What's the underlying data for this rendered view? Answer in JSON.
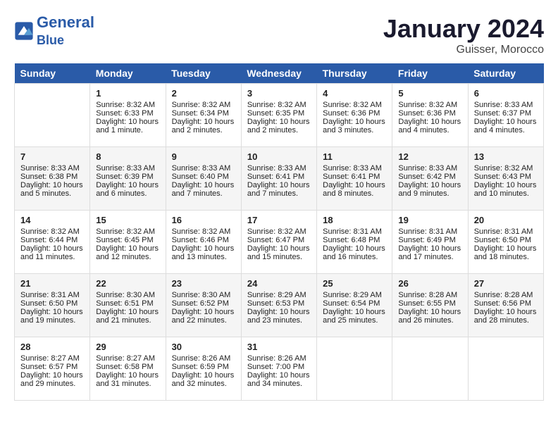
{
  "header": {
    "logo_line1": "General",
    "logo_line2": "Blue",
    "month": "January 2024",
    "location": "Guisser, Morocco"
  },
  "weekdays": [
    "Sunday",
    "Monday",
    "Tuesday",
    "Wednesday",
    "Thursday",
    "Friday",
    "Saturday"
  ],
  "weeks": [
    [
      {
        "day": "",
        "info": ""
      },
      {
        "day": "1",
        "info": "Sunrise: 8:32 AM\nSunset: 6:33 PM\nDaylight: 10 hours\nand 1 minute."
      },
      {
        "day": "2",
        "info": "Sunrise: 8:32 AM\nSunset: 6:34 PM\nDaylight: 10 hours\nand 2 minutes."
      },
      {
        "day": "3",
        "info": "Sunrise: 8:32 AM\nSunset: 6:35 PM\nDaylight: 10 hours\nand 2 minutes."
      },
      {
        "day": "4",
        "info": "Sunrise: 8:32 AM\nSunset: 6:36 PM\nDaylight: 10 hours\nand 3 minutes."
      },
      {
        "day": "5",
        "info": "Sunrise: 8:32 AM\nSunset: 6:36 PM\nDaylight: 10 hours\nand 4 minutes."
      },
      {
        "day": "6",
        "info": "Sunrise: 8:33 AM\nSunset: 6:37 PM\nDaylight: 10 hours\nand 4 minutes."
      }
    ],
    [
      {
        "day": "7",
        "info": "Sunrise: 8:33 AM\nSunset: 6:38 PM\nDaylight: 10 hours\nand 5 minutes."
      },
      {
        "day": "8",
        "info": "Sunrise: 8:33 AM\nSunset: 6:39 PM\nDaylight: 10 hours\nand 6 minutes."
      },
      {
        "day": "9",
        "info": "Sunrise: 8:33 AM\nSunset: 6:40 PM\nDaylight: 10 hours\nand 7 minutes."
      },
      {
        "day": "10",
        "info": "Sunrise: 8:33 AM\nSunset: 6:41 PM\nDaylight: 10 hours\nand 7 minutes."
      },
      {
        "day": "11",
        "info": "Sunrise: 8:33 AM\nSunset: 6:41 PM\nDaylight: 10 hours\nand 8 minutes."
      },
      {
        "day": "12",
        "info": "Sunrise: 8:33 AM\nSunset: 6:42 PM\nDaylight: 10 hours\nand 9 minutes."
      },
      {
        "day": "13",
        "info": "Sunrise: 8:32 AM\nSunset: 6:43 PM\nDaylight: 10 hours\nand 10 minutes."
      }
    ],
    [
      {
        "day": "14",
        "info": "Sunrise: 8:32 AM\nSunset: 6:44 PM\nDaylight: 10 hours\nand 11 minutes."
      },
      {
        "day": "15",
        "info": "Sunrise: 8:32 AM\nSunset: 6:45 PM\nDaylight: 10 hours\nand 12 minutes."
      },
      {
        "day": "16",
        "info": "Sunrise: 8:32 AM\nSunset: 6:46 PM\nDaylight: 10 hours\nand 13 minutes."
      },
      {
        "day": "17",
        "info": "Sunrise: 8:32 AM\nSunset: 6:47 PM\nDaylight: 10 hours\nand 15 minutes."
      },
      {
        "day": "18",
        "info": "Sunrise: 8:31 AM\nSunset: 6:48 PM\nDaylight: 10 hours\nand 16 minutes."
      },
      {
        "day": "19",
        "info": "Sunrise: 8:31 AM\nSunset: 6:49 PM\nDaylight: 10 hours\nand 17 minutes."
      },
      {
        "day": "20",
        "info": "Sunrise: 8:31 AM\nSunset: 6:50 PM\nDaylight: 10 hours\nand 18 minutes."
      }
    ],
    [
      {
        "day": "21",
        "info": "Sunrise: 8:31 AM\nSunset: 6:50 PM\nDaylight: 10 hours\nand 19 minutes."
      },
      {
        "day": "22",
        "info": "Sunrise: 8:30 AM\nSunset: 6:51 PM\nDaylight: 10 hours\nand 21 minutes."
      },
      {
        "day": "23",
        "info": "Sunrise: 8:30 AM\nSunset: 6:52 PM\nDaylight: 10 hours\nand 22 minutes."
      },
      {
        "day": "24",
        "info": "Sunrise: 8:29 AM\nSunset: 6:53 PM\nDaylight: 10 hours\nand 23 minutes."
      },
      {
        "day": "25",
        "info": "Sunrise: 8:29 AM\nSunset: 6:54 PM\nDaylight: 10 hours\nand 25 minutes."
      },
      {
        "day": "26",
        "info": "Sunrise: 8:28 AM\nSunset: 6:55 PM\nDaylight: 10 hours\nand 26 minutes."
      },
      {
        "day": "27",
        "info": "Sunrise: 8:28 AM\nSunset: 6:56 PM\nDaylight: 10 hours\nand 28 minutes."
      }
    ],
    [
      {
        "day": "28",
        "info": "Sunrise: 8:27 AM\nSunset: 6:57 PM\nDaylight: 10 hours\nand 29 minutes."
      },
      {
        "day": "29",
        "info": "Sunrise: 8:27 AM\nSunset: 6:58 PM\nDaylight: 10 hours\nand 31 minutes."
      },
      {
        "day": "30",
        "info": "Sunrise: 8:26 AM\nSunset: 6:59 PM\nDaylight: 10 hours\nand 32 minutes."
      },
      {
        "day": "31",
        "info": "Sunrise: 8:26 AM\nSunset: 7:00 PM\nDaylight: 10 hours\nand 34 minutes."
      },
      {
        "day": "",
        "info": ""
      },
      {
        "day": "",
        "info": ""
      },
      {
        "day": "",
        "info": ""
      }
    ]
  ]
}
